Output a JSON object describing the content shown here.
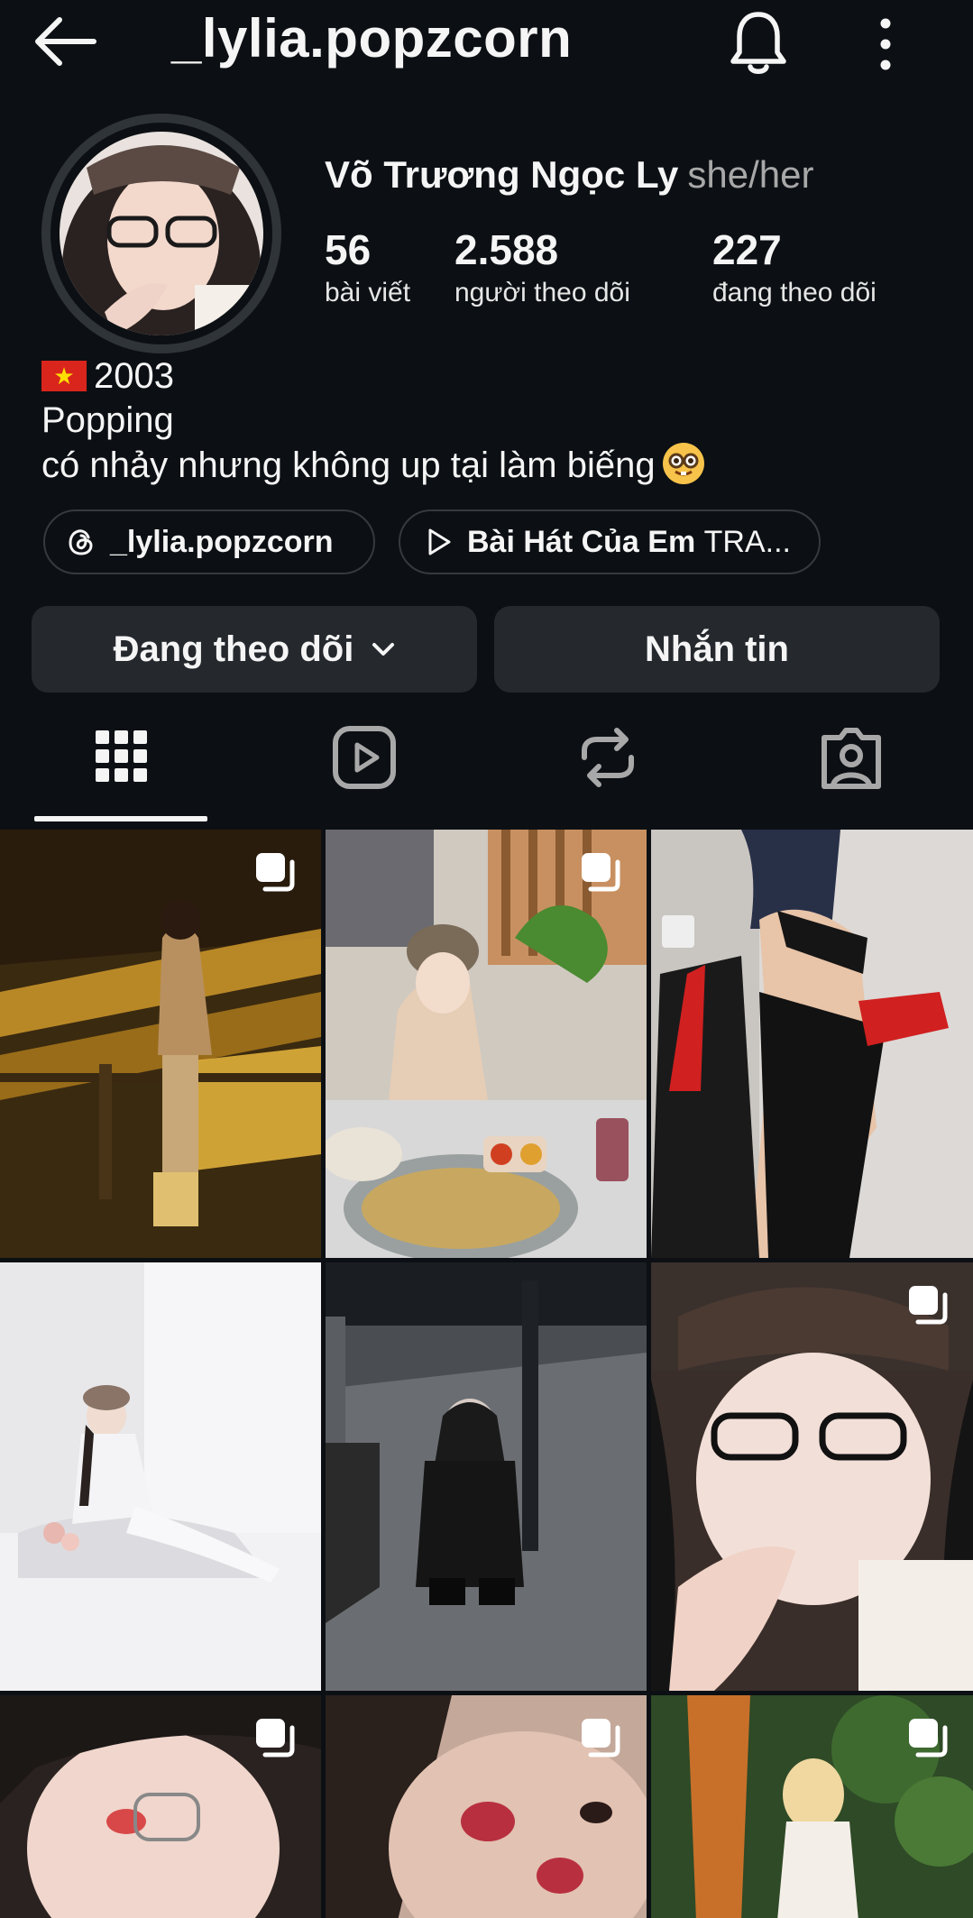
{
  "header": {
    "username": "_lylia.popzcorn",
    "back_icon": "arrow-left-icon",
    "bell_icon": "bell-icon",
    "more_icon": "more-vertical-icon"
  },
  "profile": {
    "full_name": "Võ Trương Ngọc Ly",
    "pronouns": "she/her",
    "stats": [
      {
        "value": "56",
        "label": "bài viết"
      },
      {
        "value": "2.588",
        "label": "người theo dõi"
      },
      {
        "value": "227",
        "label": "đang theo dõi"
      }
    ],
    "bio": {
      "line1": "2003",
      "line2": "Popping",
      "line3": "có nhảy nhưng không up tại làm biếng"
    }
  },
  "links": {
    "threads": {
      "text": "_lylia.popzcorn",
      "icon": "threads-icon"
    },
    "music": {
      "title": "Bài Hát Của Em",
      "artist": "TRA...",
      "icon": "play-icon"
    }
  },
  "actions": {
    "following": "Đang theo dõi",
    "message": "Nhắn tin"
  },
  "tabs": [
    {
      "name": "posts",
      "icon": "grid-icon",
      "active": true
    },
    {
      "name": "reels",
      "icon": "reels-icon",
      "active": false
    },
    {
      "name": "reposts",
      "icon": "repost-icon",
      "active": false
    },
    {
      "name": "tagged",
      "icon": "tagged-icon",
      "active": false
    }
  ],
  "posts": [
    {
      "multi": true
    },
    {
      "multi": true
    },
    {
      "multi": false
    },
    {
      "multi": false
    },
    {
      "multi": false
    },
    {
      "multi": true
    },
    {
      "multi": true
    },
    {
      "multi": true
    },
    {
      "multi": true
    }
  ],
  "colors": {
    "background": "#0c1014",
    "button": "#25292e",
    "secondary_text": "#a8a8a8"
  }
}
